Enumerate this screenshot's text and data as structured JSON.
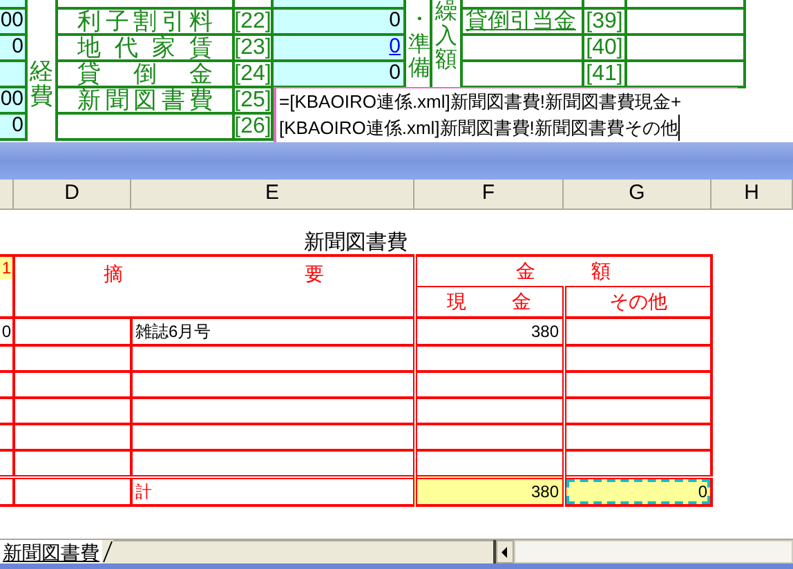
{
  "top_form": {
    "expense_label": "経費",
    "reserve_label": "・準備",
    "transfer_label": "繰入額",
    "rows": [
      {
        "left_value": "00",
        "label": "利子割引料",
        "ref": "[22]",
        "value": "0",
        "link": false
      },
      {
        "left_value": "0",
        "label": "地代家賃",
        "ref": "[23]",
        "value": "0",
        "link": true
      },
      {
        "left_value": "",
        "label": "貸倒金",
        "ref": "[24]",
        "value": "0",
        "link": false
      },
      {
        "left_value": "00",
        "label": "新聞図書費",
        "ref": "[25]",
        "value": ""
      },
      {
        "left_value": "0",
        "label": "",
        "ref": "[26]",
        "value": ""
      }
    ],
    "right_rows": [
      {
        "label": "貸倒引当金",
        "ref": "[39]"
      },
      {
        "label": "",
        "ref": "[40]"
      },
      {
        "label": "",
        "ref": "[41]"
      }
    ],
    "formula_lines": [
      "=[KBAOIRO連係.xml]新聞図書費!新聞図書費現金+",
      "[KBAOIRO連係.xml]新聞図書費!新聞図書費その他"
    ]
  },
  "sheet": {
    "columns": [
      "D",
      "E",
      "F",
      "G",
      "H"
    ],
    "title": "新聞図書費",
    "header": {
      "row_number": "1",
      "summary": "摘要",
      "amount": "金額",
      "cash": "現金",
      "other": "その他"
    },
    "rows": [
      {
        "column_c": "0",
        "description": "雑誌6月号",
        "cash": "380",
        "other": ""
      }
    ],
    "total": {
      "label": "計",
      "cash": "380",
      "other": "0",
      "other_copy_marked": true
    }
  },
  "sheet_tabs": [
    {
      "label": "新聞図書費",
      "selected": true
    }
  ]
}
